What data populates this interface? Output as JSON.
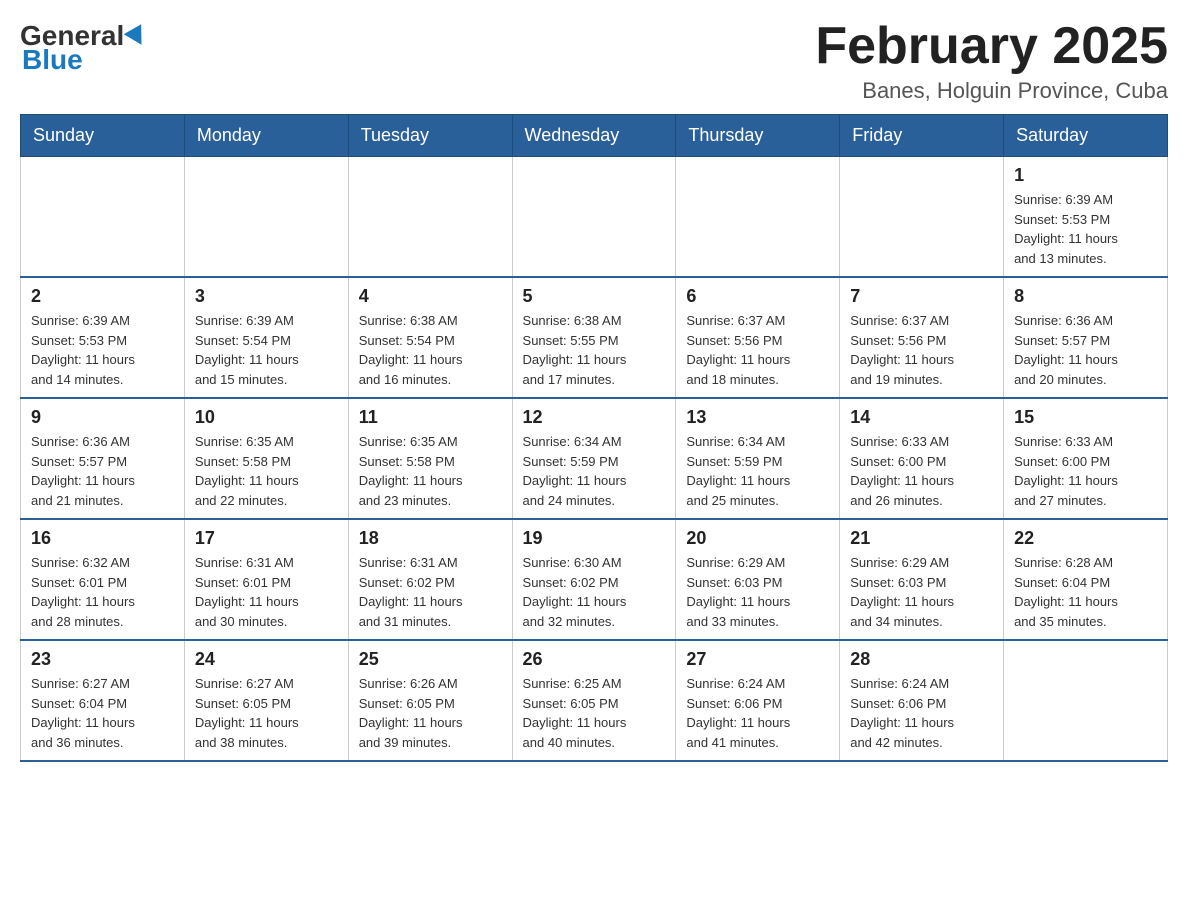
{
  "header": {
    "logo": {
      "general": "General",
      "blue": "Blue"
    },
    "title": "February 2025",
    "location": "Banes, Holguin Province, Cuba"
  },
  "days_of_week": [
    "Sunday",
    "Monday",
    "Tuesday",
    "Wednesday",
    "Thursday",
    "Friday",
    "Saturday"
  ],
  "weeks": [
    [
      {
        "day": "",
        "info": ""
      },
      {
        "day": "",
        "info": ""
      },
      {
        "day": "",
        "info": ""
      },
      {
        "day": "",
        "info": ""
      },
      {
        "day": "",
        "info": ""
      },
      {
        "day": "",
        "info": ""
      },
      {
        "day": "1",
        "info": "Sunrise: 6:39 AM\nSunset: 5:53 PM\nDaylight: 11 hours\nand 13 minutes."
      }
    ],
    [
      {
        "day": "2",
        "info": "Sunrise: 6:39 AM\nSunset: 5:53 PM\nDaylight: 11 hours\nand 14 minutes."
      },
      {
        "day": "3",
        "info": "Sunrise: 6:39 AM\nSunset: 5:54 PM\nDaylight: 11 hours\nand 15 minutes."
      },
      {
        "day": "4",
        "info": "Sunrise: 6:38 AM\nSunset: 5:54 PM\nDaylight: 11 hours\nand 16 minutes."
      },
      {
        "day": "5",
        "info": "Sunrise: 6:38 AM\nSunset: 5:55 PM\nDaylight: 11 hours\nand 17 minutes."
      },
      {
        "day": "6",
        "info": "Sunrise: 6:37 AM\nSunset: 5:56 PM\nDaylight: 11 hours\nand 18 minutes."
      },
      {
        "day": "7",
        "info": "Sunrise: 6:37 AM\nSunset: 5:56 PM\nDaylight: 11 hours\nand 19 minutes."
      },
      {
        "day": "8",
        "info": "Sunrise: 6:36 AM\nSunset: 5:57 PM\nDaylight: 11 hours\nand 20 minutes."
      }
    ],
    [
      {
        "day": "9",
        "info": "Sunrise: 6:36 AM\nSunset: 5:57 PM\nDaylight: 11 hours\nand 21 minutes."
      },
      {
        "day": "10",
        "info": "Sunrise: 6:35 AM\nSunset: 5:58 PM\nDaylight: 11 hours\nand 22 minutes."
      },
      {
        "day": "11",
        "info": "Sunrise: 6:35 AM\nSunset: 5:58 PM\nDaylight: 11 hours\nand 23 minutes."
      },
      {
        "day": "12",
        "info": "Sunrise: 6:34 AM\nSunset: 5:59 PM\nDaylight: 11 hours\nand 24 minutes."
      },
      {
        "day": "13",
        "info": "Sunrise: 6:34 AM\nSunset: 5:59 PM\nDaylight: 11 hours\nand 25 minutes."
      },
      {
        "day": "14",
        "info": "Sunrise: 6:33 AM\nSunset: 6:00 PM\nDaylight: 11 hours\nand 26 minutes."
      },
      {
        "day": "15",
        "info": "Sunrise: 6:33 AM\nSunset: 6:00 PM\nDaylight: 11 hours\nand 27 minutes."
      }
    ],
    [
      {
        "day": "16",
        "info": "Sunrise: 6:32 AM\nSunset: 6:01 PM\nDaylight: 11 hours\nand 28 minutes."
      },
      {
        "day": "17",
        "info": "Sunrise: 6:31 AM\nSunset: 6:01 PM\nDaylight: 11 hours\nand 30 minutes."
      },
      {
        "day": "18",
        "info": "Sunrise: 6:31 AM\nSunset: 6:02 PM\nDaylight: 11 hours\nand 31 minutes."
      },
      {
        "day": "19",
        "info": "Sunrise: 6:30 AM\nSunset: 6:02 PM\nDaylight: 11 hours\nand 32 minutes."
      },
      {
        "day": "20",
        "info": "Sunrise: 6:29 AM\nSunset: 6:03 PM\nDaylight: 11 hours\nand 33 minutes."
      },
      {
        "day": "21",
        "info": "Sunrise: 6:29 AM\nSunset: 6:03 PM\nDaylight: 11 hours\nand 34 minutes."
      },
      {
        "day": "22",
        "info": "Sunrise: 6:28 AM\nSunset: 6:04 PM\nDaylight: 11 hours\nand 35 minutes."
      }
    ],
    [
      {
        "day": "23",
        "info": "Sunrise: 6:27 AM\nSunset: 6:04 PM\nDaylight: 11 hours\nand 36 minutes."
      },
      {
        "day": "24",
        "info": "Sunrise: 6:27 AM\nSunset: 6:05 PM\nDaylight: 11 hours\nand 38 minutes."
      },
      {
        "day": "25",
        "info": "Sunrise: 6:26 AM\nSunset: 6:05 PM\nDaylight: 11 hours\nand 39 minutes."
      },
      {
        "day": "26",
        "info": "Sunrise: 6:25 AM\nSunset: 6:05 PM\nDaylight: 11 hours\nand 40 minutes."
      },
      {
        "day": "27",
        "info": "Sunrise: 6:24 AM\nSunset: 6:06 PM\nDaylight: 11 hours\nand 41 minutes."
      },
      {
        "day": "28",
        "info": "Sunrise: 6:24 AM\nSunset: 6:06 PM\nDaylight: 11 hours\nand 42 minutes."
      },
      {
        "day": "",
        "info": ""
      }
    ]
  ]
}
